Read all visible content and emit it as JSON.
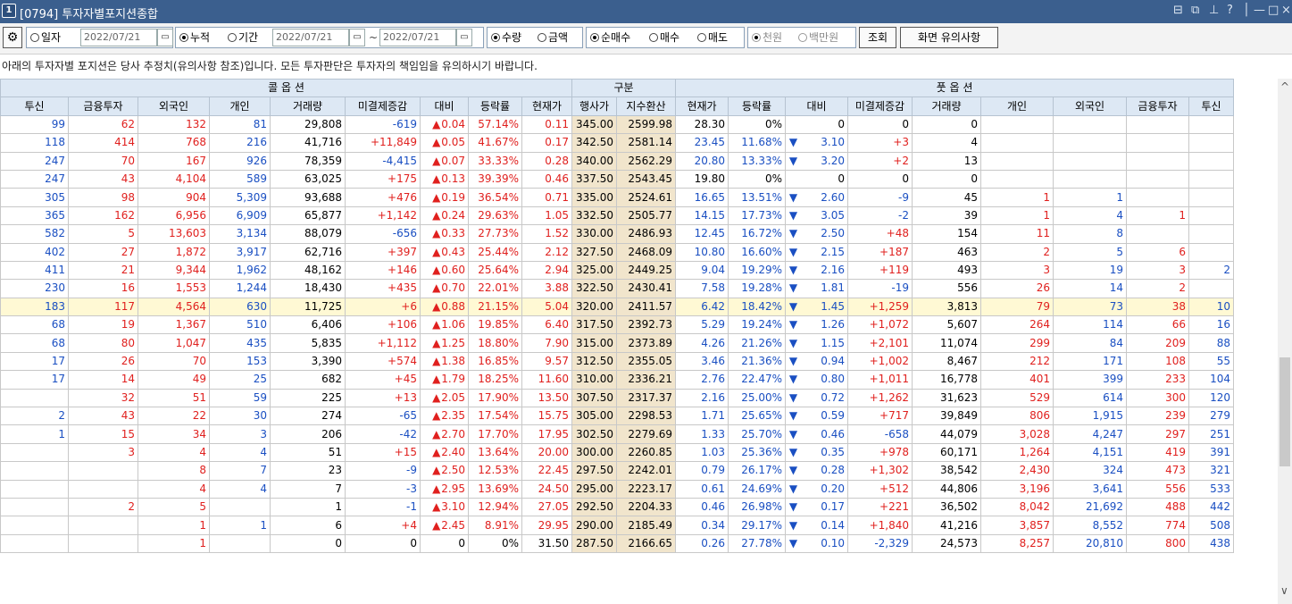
{
  "window": {
    "number": "1",
    "title": "[0794] 투자자별포지션종합",
    "controls": [
      "⊟",
      "⧉",
      "⊥",
      "?",
      "│",
      "—",
      "□",
      "×"
    ]
  },
  "toolbar": {
    "gear": "⚙",
    "opt_date": "일자",
    "date_single": "2022/07/21",
    "opt_cumulative": "누적",
    "opt_period": "기간",
    "date_from": "2022/07/21",
    "date_sep": "~",
    "date_to": "2022/07/21",
    "opt_qty": "수량",
    "opt_amount": "금액",
    "opt_netbuy": "순매수",
    "opt_buy": "매수",
    "opt_sell": "매도",
    "opt_won": "천원",
    "opt_million": "백만원",
    "btn_query": "조회",
    "btn_notice": "화면 유의사항"
  },
  "notice": "아래의 투자자별 포지션은 당사 추정치(유의사항 참조)입니다. 모든 투자판단은 투자자의 책임임을 유의하시기 바랍니다.",
  "header": {
    "call": "콜 옵 션",
    "category": "구분",
    "put": "풋 옵 션",
    "columns": [
      "투신",
      "금융투자",
      "외국인",
      "개인",
      "거래량",
      "미결제증감",
      "대비",
      "등락률",
      "현재가",
      "행사가",
      "지수환산",
      "현재가",
      "등락률",
      "대비",
      "미결제증감",
      "거래량",
      "개인",
      "외국인",
      "금융투자",
      "투신"
    ]
  },
  "rows": [
    {
      "c": [
        "99",
        "62",
        "132",
        "81",
        "29,808",
        "-619",
        "▲",
        "0.04",
        "57.14%",
        "0.11",
        "345.00",
        "2599.98",
        "28.30",
        "0%",
        "",
        "0",
        "0",
        "0",
        "",
        "",
        "",
        ""
      ]
    },
    {
      "c": [
        "118",
        "414",
        "768",
        "216",
        "41,716",
        "+11,849",
        "▲",
        "0.05",
        "41.67%",
        "0.17",
        "342.50",
        "2581.14",
        "23.45",
        "11.68%",
        "▼",
        "3.10",
        "+3",
        "4",
        "",
        "",
        "",
        ""
      ]
    },
    {
      "c": [
        "247",
        "70",
        "167",
        "926",
        "78,359",
        "-4,415",
        "▲",
        "0.07",
        "33.33%",
        "0.28",
        "340.00",
        "2562.29",
        "20.80",
        "13.33%",
        "▼",
        "3.20",
        "+2",
        "13",
        "",
        "",
        "",
        ""
      ]
    },
    {
      "c": [
        "247",
        "43",
        "4,104",
        "589",
        "63,025",
        "+175",
        "▲",
        "0.13",
        "39.39%",
        "0.46",
        "337.50",
        "2543.45",
        "19.80",
        "0%",
        "",
        "0",
        "0",
        "0",
        "",
        "",
        "",
        ""
      ]
    },
    {
      "c": [
        "305",
        "98",
        "904",
        "5,309",
        "93,688",
        "+476",
        "▲",
        "0.19",
        "36.54%",
        "0.71",
        "335.00",
        "2524.61",
        "16.65",
        "13.51%",
        "▼",
        "2.60",
        "-9",
        "45",
        "1",
        "1",
        "",
        ""
      ]
    },
    {
      "c": [
        "365",
        "162",
        "6,956",
        "6,909",
        "65,877",
        "+1,142",
        "▲",
        "0.24",
        "29.63%",
        "1.05",
        "332.50",
        "2505.77",
        "14.15",
        "17.73%",
        "▼",
        "3.05",
        "-2",
        "39",
        "1",
        "4",
        "1",
        ""
      ]
    },
    {
      "c": [
        "582",
        "5",
        "13,603",
        "3,134",
        "88,079",
        "-656",
        "▲",
        "0.33",
        "27.73%",
        "1.52",
        "330.00",
        "2486.93",
        "12.45",
        "16.72%",
        "▼",
        "2.50",
        "+48",
        "154",
        "11",
        "8",
        "",
        ""
      ]
    },
    {
      "c": [
        "402",
        "27",
        "1,872",
        "3,917",
        "62,716",
        "+397",
        "▲",
        "0.43",
        "25.44%",
        "2.12",
        "327.50",
        "2468.09",
        "10.80",
        "16.60%",
        "▼",
        "2.15",
        "+187",
        "463",
        "2",
        "5",
        "6",
        ""
      ]
    },
    {
      "c": [
        "411",
        "21",
        "9,344",
        "1,962",
        "48,162",
        "+146",
        "▲",
        "0.60",
        "25.64%",
        "2.94",
        "325.00",
        "2449.25",
        "9.04",
        "19.29%",
        "▼",
        "2.16",
        "+119",
        "493",
        "3",
        "19",
        "3",
        "2"
      ]
    },
    {
      "c": [
        "230",
        "16",
        "1,553",
        "1,244",
        "18,430",
        "+435",
        "▲",
        "0.70",
        "22.01%",
        "3.88",
        "322.50",
        "2430.41",
        "7.58",
        "19.28%",
        "▼",
        "1.81",
        "-19",
        "556",
        "26",
        "14",
        "2",
        ""
      ]
    },
    {
      "c": [
        "183",
        "117",
        "4,564",
        "630",
        "11,725",
        "+6",
        "▲",
        "0.88",
        "21.15%",
        "5.04",
        "320.00",
        "2411.57",
        "6.42",
        "18.42%",
        "▼",
        "1.45",
        "+1,259",
        "3,813",
        "79",
        "73",
        "38",
        "10"
      ]
    },
    {
      "c": [
        "68",
        "19",
        "1,367",
        "510",
        "6,406",
        "+106",
        "▲",
        "1.06",
        "19.85%",
        "6.40",
        "317.50",
        "2392.73",
        "5.29",
        "19.24%",
        "▼",
        "1.26",
        "+1,072",
        "5,607",
        "264",
        "114",
        "66",
        "16"
      ]
    },
    {
      "c": [
        "68",
        "80",
        "1,047",
        "435",
        "5,835",
        "+1,112",
        "▲",
        "1.25",
        "18.80%",
        "7.90",
        "315.00",
        "2373.89",
        "4.26",
        "21.26%",
        "▼",
        "1.15",
        "+2,101",
        "11,074",
        "299",
        "84",
        "209",
        "88"
      ]
    },
    {
      "c": [
        "17",
        "26",
        "70",
        "153",
        "3,390",
        "+574",
        "▲",
        "1.38",
        "16.85%",
        "9.57",
        "312.50",
        "2355.05",
        "3.46",
        "21.36%",
        "▼",
        "0.94",
        "+1,002",
        "8,467",
        "212",
        "171",
        "108",
        "55"
      ]
    },
    {
      "c": [
        "17",
        "14",
        "49",
        "25",
        "682",
        "+45",
        "▲",
        "1.79",
        "18.25%",
        "11.60",
        "310.00",
        "2336.21",
        "2.76",
        "22.47%",
        "▼",
        "0.80",
        "+1,011",
        "16,778",
        "401",
        "399",
        "233",
        "104"
      ]
    },
    {
      "c": [
        "",
        "32",
        "51",
        "59",
        "225",
        "+13",
        "▲",
        "2.05",
        "17.90%",
        "13.50",
        "307.50",
        "2317.37",
        "2.16",
        "25.00%",
        "▼",
        "0.72",
        "+1,262",
        "31,623",
        "529",
        "614",
        "300",
        "120"
      ]
    },
    {
      "c": [
        "2",
        "43",
        "22",
        "30",
        "274",
        "-65",
        "▲",
        "2.35",
        "17.54%",
        "15.75",
        "305.00",
        "2298.53",
        "1.71",
        "25.65%",
        "▼",
        "0.59",
        "+717",
        "39,849",
        "806",
        "1,915",
        "239",
        "279"
      ]
    },
    {
      "c": [
        "1",
        "15",
        "34",
        "3",
        "206",
        "-42",
        "▲",
        "2.70",
        "17.70%",
        "17.95",
        "302.50",
        "2279.69",
        "1.33",
        "25.70%",
        "▼",
        "0.46",
        "-658",
        "44,079",
        "3,028",
        "4,247",
        "297",
        "251"
      ]
    },
    {
      "c": [
        "",
        "3",
        "4",
        "4",
        "51",
        "+15",
        "▲",
        "2.40",
        "13.64%",
        "20.00",
        "300.00",
        "2260.85",
        "1.03",
        "25.36%",
        "▼",
        "0.35",
        "+978",
        "60,171",
        "1,264",
        "4,151",
        "419",
        "391"
      ]
    },
    {
      "c": [
        "",
        "",
        "8",
        "7",
        "23",
        "-9",
        "▲",
        "2.50",
        "12.53%",
        "22.45",
        "297.50",
        "2242.01",
        "0.79",
        "26.17%",
        "▼",
        "0.28",
        "+1,302",
        "38,542",
        "2,430",
        "324",
        "473",
        "321"
      ]
    },
    {
      "c": [
        "",
        "",
        "4",
        "4",
        "7",
        "-3",
        "▲",
        "2.95",
        "13.69%",
        "24.50",
        "295.00",
        "2223.17",
        "0.61",
        "24.69%",
        "▼",
        "0.20",
        "+512",
        "44,806",
        "3,196",
        "3,641",
        "556",
        "533"
      ]
    },
    {
      "c": [
        "",
        "2",
        "5",
        "",
        "1",
        "-1",
        "▲",
        "3.10",
        "12.94%",
        "27.05",
        "292.50",
        "2204.33",
        "0.46",
        "26.98%",
        "▼",
        "0.17",
        "+221",
        "36,502",
        "8,042",
        "21,692",
        "488",
        "442"
      ]
    },
    {
      "c": [
        "",
        "",
        "1",
        "1",
        "6",
        "+4",
        "▲",
        "2.45",
        "8.91%",
        "29.95",
        "290.00",
        "2185.49",
        "0.34",
        "29.17%",
        "▼",
        "0.14",
        "+1,840",
        "41,216",
        "3,857",
        "8,552",
        "774",
        "508"
      ]
    },
    {
      "c": [
        "",
        "",
        "1",
        "",
        "0",
        "0",
        "",
        "0",
        "0%",
        "31.50",
        "287.50",
        "2166.65",
        "0.26",
        "27.78%",
        "▼",
        "0.10",
        "-2,329",
        "24,573",
        "8,257",
        "20,810",
        "800",
        "438"
      ]
    }
  ],
  "highlight_row": 10,
  "colors": {
    "titlebar": "#3b5f8e",
    "header": "#dde8f4",
    "strike": "#f1e5cc",
    "highlight": "#fff9d4",
    "up": "#e0201e",
    "down": "#1a4fc2"
  },
  "scroll": {
    "up": "^",
    "down": "∨"
  }
}
